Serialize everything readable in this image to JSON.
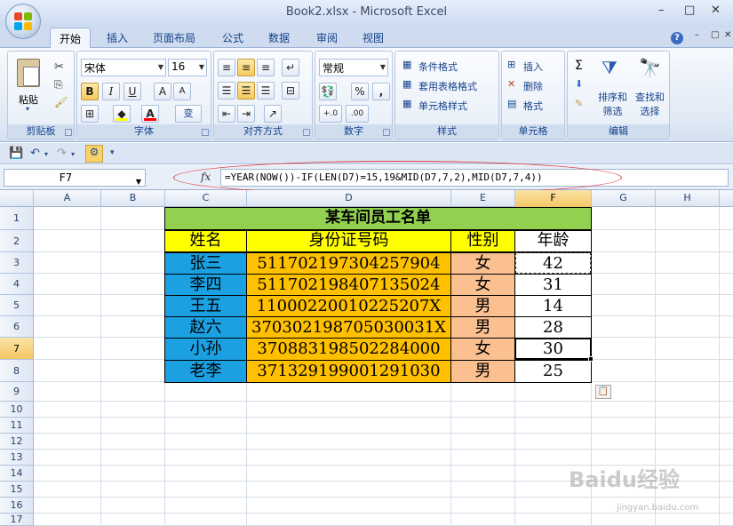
{
  "window": {
    "title": "Book2.xlsx - Microsoft Excel",
    "minimize": "–",
    "restore": "□",
    "close": "✕",
    "help": "?"
  },
  "tabs": [
    "开始",
    "插入",
    "页面布局",
    "公式",
    "数据",
    "审阅",
    "视图"
  ],
  "active_tab": "开始",
  "ribbon": {
    "clipboard": {
      "label": "剪贴板",
      "paste": "粘贴"
    },
    "font": {
      "label": "字体",
      "name": "宋体",
      "size": "16",
      "bold": "B",
      "italic": "I",
      "underline": "U",
      "grow": "A",
      "shrink": "A",
      "fill_color": "#ffff00",
      "font_color": "#ff0000",
      "phonetic": "变"
    },
    "alignment": {
      "label": "对齐方式"
    },
    "number": {
      "label": "数字",
      "format": "常规",
      "percent": "%",
      "comma": ",",
      "inc_decimal": "+.0",
      "dec_decimal": ".00"
    },
    "styles": {
      "label": "样式",
      "conditional": "条件格式",
      "table": "套用表格格式",
      "cell_styles": "单元格样式"
    },
    "cells": {
      "label": "单元格",
      "insert": "插入",
      "delete": "删除",
      "format": "格式"
    },
    "editing": {
      "label": "编辑",
      "sum": "Σ",
      "sort_filter": "排序和\n筛选",
      "find_select": "查找和\n选择"
    }
  },
  "formula_bar": {
    "name_box": "F7",
    "fx": "fx",
    "formula": "=YEAR(NOW())-IF(LEN(D7)=15,19&MID(D7,7,2),MID(D7,7,4))"
  },
  "columns": [
    "A",
    "B",
    "C",
    "D",
    "E",
    "F",
    "G",
    "H"
  ],
  "selected_column": "F",
  "rows": [
    "1",
    "2",
    "3",
    "4",
    "5",
    "6",
    "7",
    "8",
    "9",
    "10",
    "11",
    "12",
    "13",
    "14",
    "15",
    "16",
    "17"
  ],
  "selected_row": "7",
  "sheet": {
    "title": "某车间员工名单",
    "headers": [
      "姓名",
      "身份证号码",
      "性别",
      "年龄"
    ],
    "records": [
      {
        "name": "张三",
        "id": "511702197304257904",
        "sex": "女",
        "age": "42"
      },
      {
        "name": "李四",
        "id": "511702198407135024",
        "sex": "女",
        "age": "31"
      },
      {
        "name": "王五",
        "id": "11000220010225207X",
        "sex": "男",
        "age": "14"
      },
      {
        "name": "赵六",
        "id": "370302198705030031X",
        "sex": "男",
        "age": "28"
      },
      {
        "name": "小孙",
        "id": "370883198502284000",
        "sex": "女",
        "age": "30"
      },
      {
        "name": "老李",
        "id": "371329199001291030",
        "sex": "男",
        "age": "25"
      }
    ]
  },
  "watermark": {
    "brand": "Baidu经验",
    "url": "jingyan.baidu.com"
  }
}
